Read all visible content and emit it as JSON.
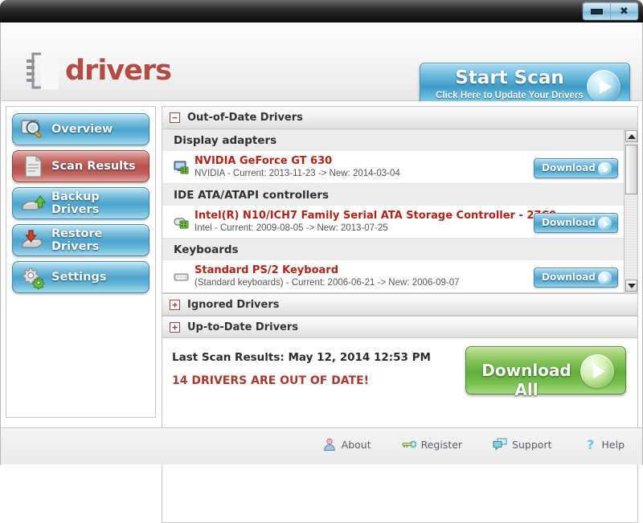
{
  "window": {
    "minimize_label": "Minimize",
    "close_label": "Close"
  },
  "header": {
    "logo_text": "drivers",
    "start_scan": {
      "title": "Start Scan",
      "subtitle": "Click Here to Update Your Drivers",
      "icon": "play-circle-icon"
    }
  },
  "sidebar": {
    "items": [
      {
        "label": "Overview",
        "icon": "magnifier-icon",
        "active": false
      },
      {
        "label": "Scan Results",
        "icon": "document-icon",
        "active": true
      },
      {
        "label": "Backup Drivers",
        "icon": "drive-up-arrow-icon",
        "active": false
      },
      {
        "label": "Restore Drivers",
        "icon": "drive-down-arrow-icon",
        "active": false
      },
      {
        "label": "Settings",
        "icon": "gears-icon",
        "active": false
      }
    ]
  },
  "content": {
    "sections": [
      {
        "title": "Out-of-Date Drivers",
        "expander": "−",
        "expanded": true
      },
      {
        "title": "Ignored Drivers",
        "expander": "+",
        "expanded": false
      },
      {
        "title": "Up-to-Date Drivers",
        "expander": "+",
        "expanded": false
      }
    ],
    "groups": [
      {
        "name": "Display adapters",
        "rows": [
          {
            "name": "NVIDIA GeForce GT 630",
            "meta": "NVIDIA - Current: 2013-11-23 -> New: 2014-03-04",
            "icon": "display-adapter-icon",
            "button": "Download"
          }
        ]
      },
      {
        "name": "IDE ATA/ATAPI controllers",
        "rows": [
          {
            "name": "Intel(R) N10/ICH7 Family Serial ATA Storage Controller - 27C0",
            "meta": "Intel - Current: 2009-08-05 -> New: 2013-07-25",
            "icon": "storage-controller-icon",
            "button": "Download"
          }
        ]
      },
      {
        "name": "Keyboards",
        "rows": [
          {
            "name": "Standard PS/2 Keyboard",
            "meta": "(Standard keyboards) - Current: 2006-06-21 -> New: 2006-09-07",
            "icon": "keyboard-icon",
            "button": "Download"
          }
        ]
      }
    ],
    "scrollbar": {
      "up": "▲",
      "down": "▼"
    }
  },
  "results": {
    "last_scan": "Last Scan Results: May 12, 2014 12:53 PM",
    "out_of_date": "14 DRIVERS ARE OUT OF DATE!",
    "download_all": {
      "label": "Download All",
      "icon": "play-circle-icon"
    }
  },
  "footer": {
    "links": [
      {
        "label": "About",
        "icon": "person-icon"
      },
      {
        "label": "Register",
        "icon": "key-icon"
      },
      {
        "label": "Support",
        "icon": "chat-bubbles-icon"
      },
      {
        "label": "Help",
        "icon": "question-mark-icon"
      }
    ]
  },
  "colors": {
    "accent_red": "#b02418",
    "accent_blue": "#4ba3cc",
    "accent_green": "#5fae3d",
    "titlebar": "#1a1a1a"
  }
}
